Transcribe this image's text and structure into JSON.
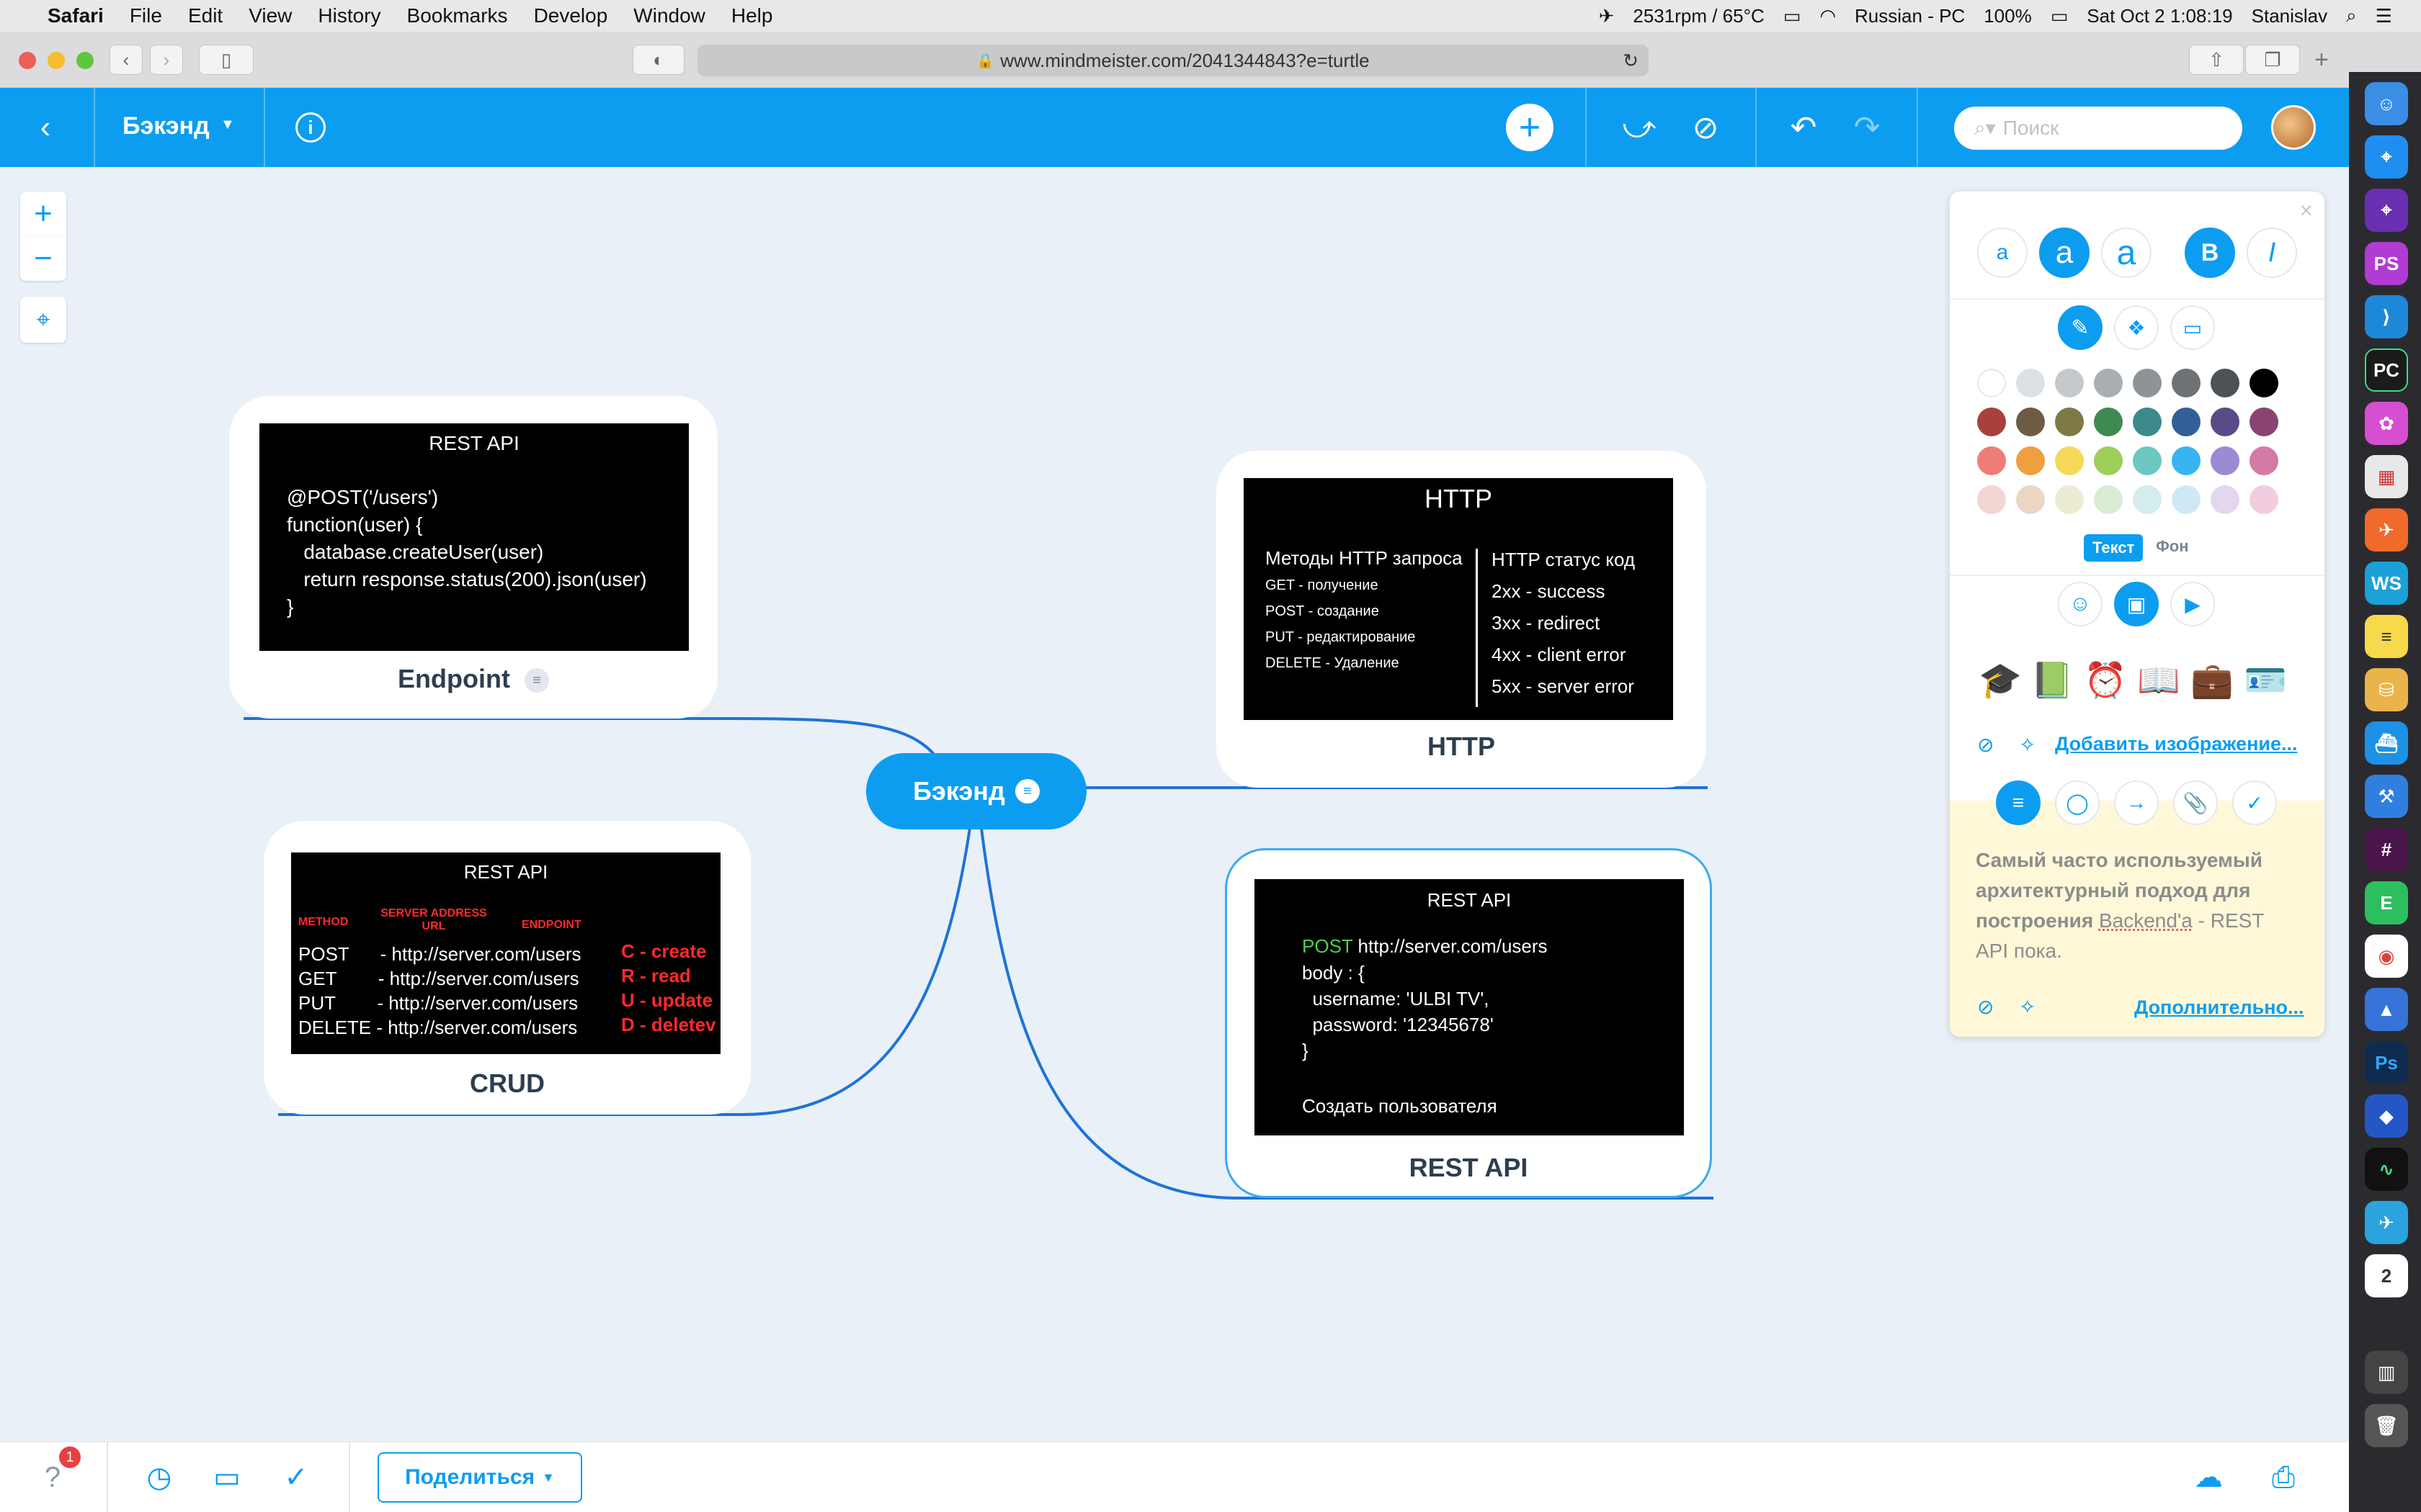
{
  "menubar": {
    "app": "Safari",
    "items": [
      "File",
      "Edit",
      "View",
      "History",
      "Bookmarks",
      "Develop",
      "Window",
      "Help"
    ],
    "status": {
      "fan": "2531rpm / 65°C",
      "input": "Russian - PC",
      "battery": "100%",
      "datetime": "Sat Oct 2  1:08:19",
      "user": "Stanislav"
    }
  },
  "browser": {
    "url": "www.mindmeister.com/2041344843?e=turtle"
  },
  "header": {
    "map_title": "Бэкэнд",
    "search_placeholder": "Поиск"
  },
  "map": {
    "central": "Бэкэнд",
    "nodes": {
      "endpoint": {
        "caption": "Endpoint",
        "img_title": "REST API",
        "code": "@POST('/users')\nfunction(user) {\n   database.createUser(user)\n   return response.status(200).json(user)\n}"
      },
      "http": {
        "caption": "HTTP",
        "img_title": "HTTP",
        "methods_title": "Методы HTTP запроса",
        "methods": [
          "GET - получение",
          "POST - создание",
          "PUT - редактирование",
          "DELETE - Удаление"
        ],
        "status_title": "HTTP статус код",
        "statuses": [
          "2xx - success",
          "3xx - redirect",
          "4xx - client error",
          "5xx - server error"
        ]
      },
      "crud": {
        "caption": "CRUD",
        "img_title": "REST API",
        "col_method": "METHOD",
        "col_server": "SERVER ADDRESS URL",
        "col_endpoint": "ENDPOINT",
        "rows": [
          "POST      - http://server.com/users",
          "GET        - http://server.com/users",
          "PUT        - http://server.com/users",
          "DELETE - http://server.com/users"
        ],
        "letters": [
          "C - create",
          "R - read",
          "U - update",
          "D - deletev"
        ]
      },
      "restapi": {
        "caption": "REST API",
        "img_title": "REST API",
        "method": "POST",
        "url": " http://server.com/users",
        "body": "body : {\n  username: 'ULBI TV',\n  password: '12345678'\n}",
        "footer": "Создать пользователя"
      }
    }
  },
  "panel": {
    "font_sizes": [
      "a",
      "a",
      "a"
    ],
    "bold": "B",
    "italic": "I",
    "tab_text": "Текст",
    "tab_bg": "Фон",
    "add_image": "Добавить изображение...",
    "note_text_1": "Самый часто используемый архитектурный подход для построения ",
    "note_word": "Backend'a",
    "note_text_2": " - REST API пока.",
    "more": "Дополнительно...",
    "colors": [
      [
        "#ffffff",
        "#dde1e5",
        "#c4c9ce",
        "#a9aeb3",
        "#8e9398",
        "#6e7378",
        "#4d5257",
        "#000000"
      ],
      [
        "#a7413b",
        "#6e5b45",
        "#7e7a45",
        "#3f8a52",
        "#3c8a8c",
        "#325f96",
        "#5a4a88",
        "#8a4472"
      ],
      [
        "#ee7d77",
        "#ef9f3f",
        "#f6d95a",
        "#9fce5b",
        "#6cc7c2",
        "#39b4f0",
        "#9b8bd3",
        "#d37aa6"
      ],
      [
        "#f2d6d4",
        "#ecd7c4",
        "#ececd3",
        "#d9ebd2",
        "#d3ecec",
        "#cfe8f6",
        "#e2d7ef",
        "#f2cde0"
      ]
    ]
  },
  "bottom": {
    "share": "Поделиться",
    "badge": "1"
  }
}
